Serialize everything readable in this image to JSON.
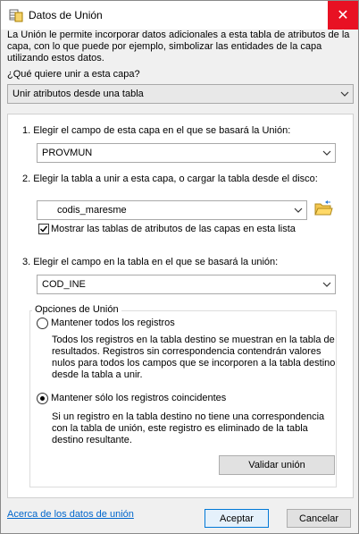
{
  "window": {
    "title": "Datos de Unión",
    "close_symbol": "✕"
  },
  "intro_text": "La Unión le permite incorporar datos adicionales a esta tabla de atributos de la capa, con lo que puede por ejemplo, simbolizar las entidades de la capa utilizando estos datos.",
  "question": "¿Qué quiere unir a esta capa?",
  "join_type": {
    "value": "Unir atributos desde una tabla"
  },
  "step1": {
    "label": "1. Elegir el campo de esta capa en el que se basará la Unión:",
    "value": "PROVMUN"
  },
  "step2": {
    "label": "2. Elegir la tabla a unir a esta capa, o cargar la tabla desde el disco:",
    "value": "codis_maresme",
    "checkbox_label": "Mostrar las tablas de atributos de las capas en esta lista",
    "checkbox_checked": true
  },
  "step3": {
    "label": "3. Elegir el campo en la tabla en el que se basará la unión:",
    "value": "COD_INE"
  },
  "options": {
    "legend": "Opciones de Unión",
    "keep_all": {
      "label": "Mantener todos los registros",
      "selected": false,
      "desc": [
        "Todos los registros en la tabla destino se muestran en la tabla de",
        "resultados. Registros sin correspondencia contendrán valores",
        "nulos para todos los campos que se incorporen a la tabla destino",
        "desde la tabla a unir."
      ]
    },
    "keep_matching": {
      "label": "Mantener sólo los registros coincidentes",
      "selected": true,
      "desc": [
        "Si un registro en la tabla destino no tiene una correspondencia",
        "con la tabla de unión, este registro es eliminado de la tabla",
        "destino resultante."
      ]
    }
  },
  "validate_button": "Validar unión",
  "footer": {
    "link": "Acerca de los datos de unión",
    "ok": "Aceptar",
    "cancel": "Cancelar"
  }
}
